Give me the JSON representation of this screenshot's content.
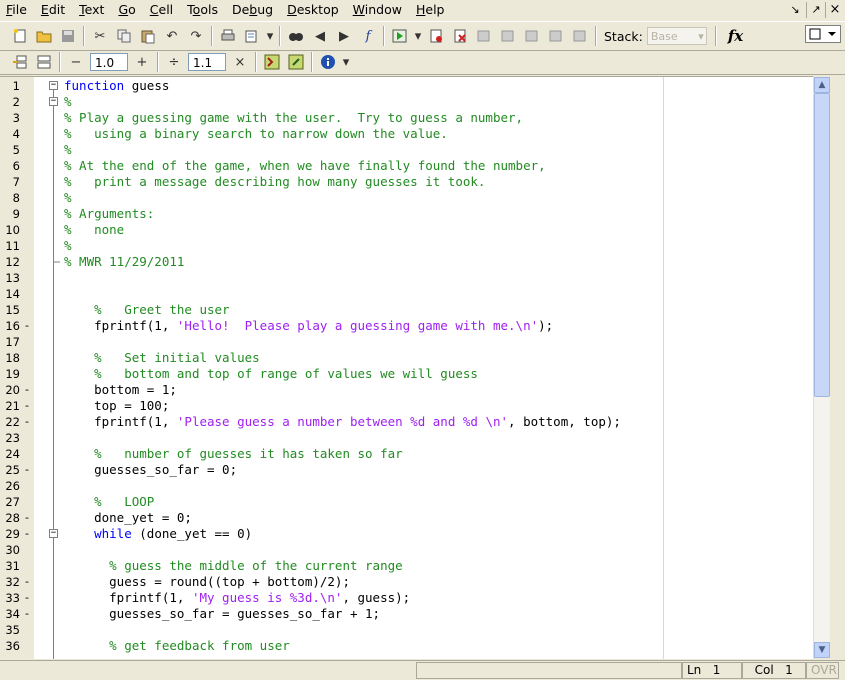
{
  "menu": [
    "File",
    "Edit",
    "Text",
    "Go",
    "Cell",
    "Tools",
    "Debug",
    "Desktop",
    "Window",
    "Help"
  ],
  "menu_underline": [
    "F",
    "E",
    "T",
    "G",
    "C",
    "o",
    "b",
    "D",
    "W",
    "H"
  ],
  "window_controls": {
    "undock": "↘",
    "dock": "↗",
    "close": "×"
  },
  "toolbar": {
    "stack_label": "Stack:",
    "stack_value": "Base",
    "fx_label": "fx"
  },
  "cell_toolbar": {
    "minus": "−",
    "decrement_value": "1.0",
    "plus": "+",
    "divide": "÷",
    "divisor_value": "1.1",
    "times": "×"
  },
  "lines": [
    {
      "n": "1",
      "bp": "",
      "fold": "minus",
      "parts": [
        {
          "t": "kw",
          "s": "function"
        },
        {
          "t": "",
          "s": " guess"
        }
      ]
    },
    {
      "n": "2",
      "bp": "",
      "fold": "minus",
      "parts": [
        {
          "t": "cm",
          "s": "%"
        }
      ]
    },
    {
      "n": "3",
      "bp": "",
      "fold": "",
      "parts": [
        {
          "t": "cm",
          "s": "% Play a guessing game with the user.  Try to guess a number,"
        }
      ]
    },
    {
      "n": "4",
      "bp": "",
      "fold": "",
      "parts": [
        {
          "t": "cm",
          "s": "%   using a binary search to narrow down the value."
        }
      ]
    },
    {
      "n": "5",
      "bp": "",
      "fold": "",
      "parts": [
        {
          "t": "cm",
          "s": "%"
        }
      ]
    },
    {
      "n": "6",
      "bp": "",
      "fold": "",
      "parts": [
        {
          "t": "cm",
          "s": "% At the end of the game, when we have finally found the number,"
        }
      ]
    },
    {
      "n": "7",
      "bp": "",
      "fold": "",
      "parts": [
        {
          "t": "cm",
          "s": "%   print a message describing how many guesses it took."
        }
      ]
    },
    {
      "n": "8",
      "bp": "",
      "fold": "",
      "parts": [
        {
          "t": "cm",
          "s": "%"
        }
      ]
    },
    {
      "n": "9",
      "bp": "",
      "fold": "",
      "parts": [
        {
          "t": "cm",
          "s": "% Arguments:"
        }
      ]
    },
    {
      "n": "10",
      "bp": "",
      "fold": "",
      "parts": [
        {
          "t": "cm",
          "s": "%   none"
        }
      ]
    },
    {
      "n": "11",
      "bp": "",
      "fold": "",
      "parts": [
        {
          "t": "cm",
          "s": "%"
        }
      ]
    },
    {
      "n": "12",
      "bp": "",
      "fold": "end",
      "parts": [
        {
          "t": "cm",
          "s": "% MWR 11/29/2011"
        }
      ]
    },
    {
      "n": "13",
      "bp": "",
      "fold": "",
      "parts": []
    },
    {
      "n": "14",
      "bp": "",
      "fold": "",
      "parts": []
    },
    {
      "n": "15",
      "bp": "",
      "fold": "",
      "parts": [
        {
          "t": "",
          "s": "    "
        },
        {
          "t": "cm",
          "s": "%   Greet the user"
        }
      ]
    },
    {
      "n": "16",
      "bp": "-",
      "fold": "",
      "parts": [
        {
          "t": "",
          "s": "    fprintf(1, "
        },
        {
          "t": "st",
          "s": "'Hello!  Please play a guessing game with me.\\n'"
        },
        {
          "t": "",
          "s": ");"
        }
      ]
    },
    {
      "n": "17",
      "bp": "",
      "fold": "",
      "parts": []
    },
    {
      "n": "18",
      "bp": "",
      "fold": "",
      "parts": [
        {
          "t": "",
          "s": "    "
        },
        {
          "t": "cm",
          "s": "%   Set initial values"
        }
      ]
    },
    {
      "n": "19",
      "bp": "",
      "fold": "",
      "parts": [
        {
          "t": "",
          "s": "    "
        },
        {
          "t": "cm",
          "s": "%   bottom and top of range of values we will guess"
        }
      ]
    },
    {
      "n": "20",
      "bp": "-",
      "fold": "",
      "parts": [
        {
          "t": "",
          "s": "    bottom = 1;"
        }
      ]
    },
    {
      "n": "21",
      "bp": "-",
      "fold": "",
      "parts": [
        {
          "t": "",
          "s": "    top = 100;"
        }
      ]
    },
    {
      "n": "22",
      "bp": "-",
      "fold": "",
      "parts": [
        {
          "t": "",
          "s": "    fprintf(1, "
        },
        {
          "t": "st",
          "s": "'Please guess a number between %d and %d \\n'"
        },
        {
          "t": "",
          "s": ", bottom, top);"
        }
      ]
    },
    {
      "n": "23",
      "bp": "",
      "fold": "",
      "parts": []
    },
    {
      "n": "24",
      "bp": "",
      "fold": "",
      "parts": [
        {
          "t": "",
          "s": "    "
        },
        {
          "t": "cm",
          "s": "%   number of guesses it has taken so far"
        }
      ]
    },
    {
      "n": "25",
      "bp": "-",
      "fold": "",
      "parts": [
        {
          "t": "",
          "s": "    guesses_so_far = 0;"
        }
      ]
    },
    {
      "n": "26",
      "bp": "",
      "fold": "",
      "parts": []
    },
    {
      "n": "27",
      "bp": "",
      "fold": "",
      "parts": [
        {
          "t": "",
          "s": "    "
        },
        {
          "t": "cm",
          "s": "%   LOOP"
        }
      ]
    },
    {
      "n": "28",
      "bp": "-",
      "fold": "",
      "parts": [
        {
          "t": "",
          "s": "    done_yet = 0;"
        }
      ]
    },
    {
      "n": "29",
      "bp": "-",
      "fold": "minus",
      "parts": [
        {
          "t": "",
          "s": "    "
        },
        {
          "t": "kw",
          "s": "while"
        },
        {
          "t": "",
          "s": " (done_yet == 0)"
        }
      ]
    },
    {
      "n": "30",
      "bp": "",
      "fold": "",
      "parts": []
    },
    {
      "n": "31",
      "bp": "",
      "fold": "",
      "parts": [
        {
          "t": "",
          "s": "      "
        },
        {
          "t": "cm",
          "s": "% guess the middle of the current range"
        }
      ]
    },
    {
      "n": "32",
      "bp": "-",
      "fold": "",
      "parts": [
        {
          "t": "",
          "s": "      guess = round((top + bottom)/2);"
        }
      ]
    },
    {
      "n": "33",
      "bp": "-",
      "fold": "",
      "parts": [
        {
          "t": "",
          "s": "      fprintf(1, "
        },
        {
          "t": "st",
          "s": "'My guess is %3d.\\n'"
        },
        {
          "t": "",
          "s": ", guess);"
        }
      ]
    },
    {
      "n": "34",
      "bp": "-",
      "fold": "",
      "parts": [
        {
          "t": "",
          "s": "      guesses_so_far = guesses_so_far + 1;"
        }
      ]
    },
    {
      "n": "35",
      "bp": "",
      "fold": "",
      "parts": []
    },
    {
      "n": "36",
      "bp": "",
      "fold": "",
      "parts": [
        {
          "t": "",
          "s": "      "
        },
        {
          "t": "cm",
          "s": "% get feedback from user"
        }
      ]
    }
  ],
  "status": {
    "ln_label": "Ln",
    "ln_value": "1",
    "col_label": "Col",
    "col_value": "1",
    "ovr": "OVR"
  },
  "colors": {
    "keyword": "#0000ff",
    "comment": "#228b22",
    "string": "#a020f0"
  }
}
